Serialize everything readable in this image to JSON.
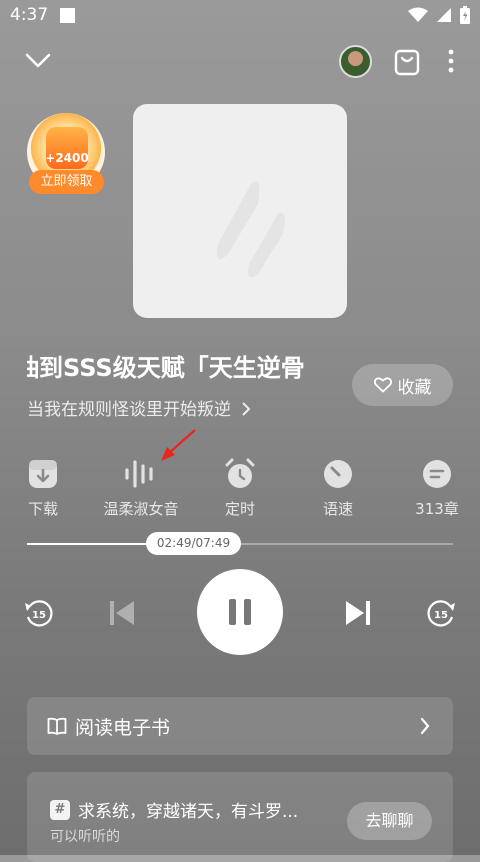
{
  "status_bar": {
    "time": "4:37"
  },
  "reward": {
    "amount": "+2400",
    "claim_label": "立即领取"
  },
  "book": {
    "title": "抽到SSS级天赋「天生逆骨",
    "subtitle": "当我在规则怪谈里开始叛逆"
  },
  "collect_label": "收藏",
  "functions": [
    {
      "label": "下载",
      "icon": "download-icon"
    },
    {
      "label": "温柔淑女音",
      "icon": "voice-wave-icon"
    },
    {
      "label": "定时",
      "icon": "alarm-clock-icon"
    },
    {
      "label": "语速",
      "icon": "speed-gauge-icon"
    },
    {
      "label": "313章",
      "icon": "chapter-list-icon"
    }
  ],
  "progress": {
    "time": "02:49/07:49",
    "fraction": 0.36
  },
  "controls": {
    "rewind_seconds": "15",
    "forward_seconds": "15"
  },
  "ebook": {
    "label": "阅读电子书"
  },
  "chat": {
    "title": "求系统，穿越诸天，有斗罗...",
    "subtitle": "可以听听的",
    "button": "去聊聊"
  },
  "colors": {
    "accent_orange": "#ff8a2b",
    "annotation_red": "#e8251f"
  }
}
